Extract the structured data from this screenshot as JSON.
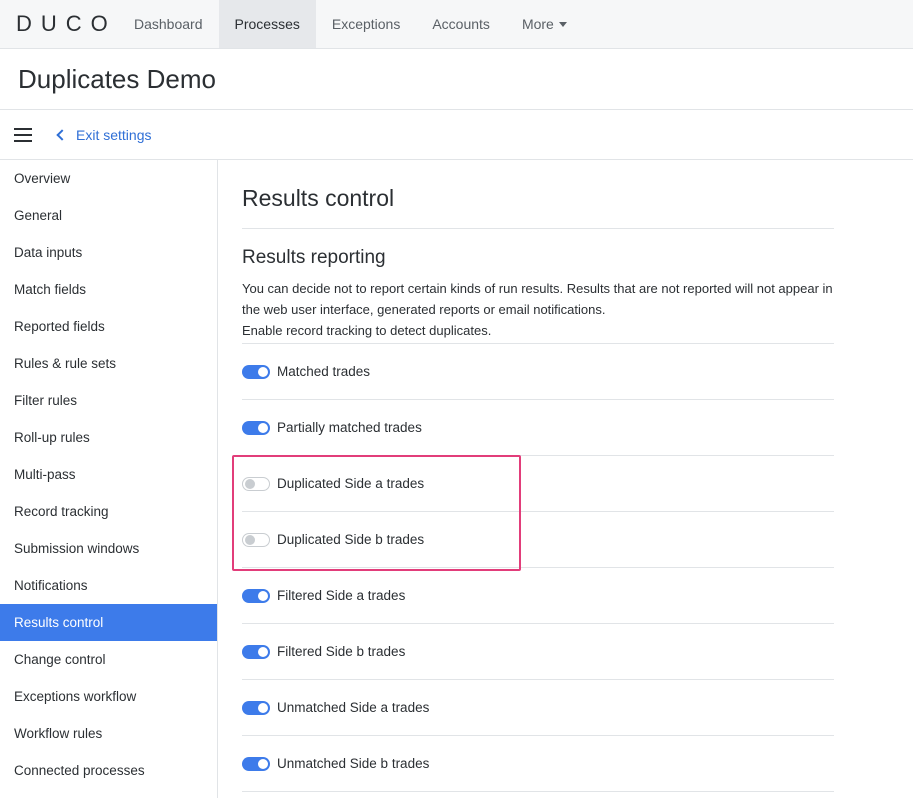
{
  "nav": {
    "logo": "DUCO",
    "items": [
      {
        "label": "Dashboard",
        "active": false
      },
      {
        "label": "Processes",
        "active": true
      },
      {
        "label": "Exceptions",
        "active": false
      },
      {
        "label": "Accounts",
        "active": false
      },
      {
        "label": "More",
        "active": false
      }
    ]
  },
  "page": {
    "title": "Duplicates Demo"
  },
  "settings_bar": {
    "exit_label": "Exit settings"
  },
  "sidebar": {
    "items": [
      "Overview",
      "General",
      "Data inputs",
      "Match fields",
      "Reported fields",
      "Rules & rule sets",
      "Filter rules",
      "Roll-up rules",
      "Multi-pass",
      "Record tracking",
      "Submission windows",
      "Notifications",
      "Results control",
      "Change control",
      "Exceptions workflow",
      "Workflow rules",
      "Connected processes"
    ],
    "active": "Results control"
  },
  "main": {
    "title": "Results control",
    "section_title": "Results reporting",
    "description": [
      "You can decide not to report certain kinds of run results. Results that are not reported will not appear in the web user interface, generated reports or email notifications.",
      "Enable record tracking to detect duplicates."
    ],
    "toggles": [
      {
        "label": "Matched trades",
        "on": true
      },
      {
        "label": "Partially matched trades",
        "on": true
      },
      {
        "label": "Duplicated Side a trades",
        "on": false
      },
      {
        "label": "Duplicated Side b trades",
        "on": false
      },
      {
        "label": "Filtered Side a trades",
        "on": true
      },
      {
        "label": "Filtered Side b trades",
        "on": true
      },
      {
        "label": "Unmatched Side a trades",
        "on": true
      },
      {
        "label": "Unmatched Side b trades",
        "on": true
      }
    ]
  },
  "colors": {
    "accent": "#3d7bea",
    "link": "#2f6fd6",
    "highlight": "#e23d7a"
  }
}
